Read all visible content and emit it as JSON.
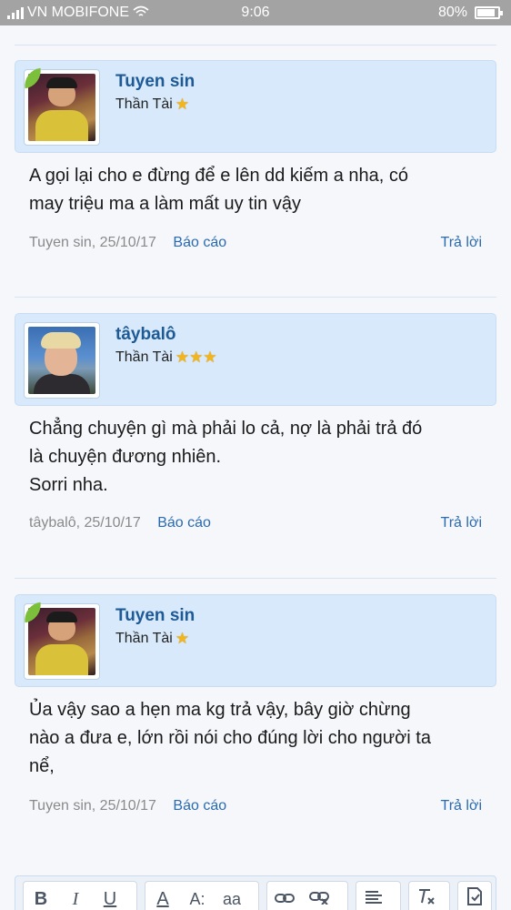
{
  "status_bar": {
    "carrier": "VN MOBIFONE",
    "time": "9:06",
    "battery": "80%",
    "battery_level": 0.8
  },
  "posts": [
    {
      "username": "Tuyen sin",
      "rank": "Thần Tài",
      "star_count": 1,
      "avatar": "child-photo-avatar",
      "message_lines": [
        "A gọi lại cho e đừng để e lên dd kiếm a nha, có",
        "may triệu ma a làm mất uy tin vậy"
      ],
      "meta": "Tuyen sin, 25/10/17",
      "report_label": "Báo cáo",
      "reply_label": "Trả lời"
    },
    {
      "username": "tâybalô",
      "rank": "Thần Tài",
      "star_count": 3,
      "avatar": "man-photo-avatar",
      "message_lines": [
        "Chẳng chuyện gì mà phải lo cả, nợ là phải trả đó",
        "là chuyện đương nhiên.",
        "Sorri nha."
      ],
      "meta": "tâybalô, 25/10/17",
      "report_label": "Báo cáo",
      "reply_label": "Trả lời"
    },
    {
      "username": "Tuyen sin",
      "rank": "Thần Tài",
      "star_count": 1,
      "avatar": "child-photo-avatar",
      "message_lines": [
        "Ủa vậy sao a hẹn ma kg trả vậy, bây giờ chừng",
        "nào a đưa e, lớn rồi nói cho đúng lời cho người ta",
        "nể,"
      ],
      "meta": "Tuyen sin, 25/10/17",
      "report_label": "Báo cáo",
      "reply_label": "Trả lời"
    }
  ],
  "editor_toolbar": {
    "bold": "B",
    "italic": "I",
    "underline": "U",
    "font_color": "A",
    "font_size": "A:",
    "font_family": "aa",
    "icons": [
      "link-icon",
      "unlink-icon",
      "align-icon",
      "remove-format-icon",
      "attach-icon"
    ]
  },
  "colors": {
    "status_bar": "#a3a3a3",
    "card_background": "#d7e9fb",
    "username": "#1e5a96",
    "link": "#2a6ab0",
    "star": "#f2b51b"
  }
}
